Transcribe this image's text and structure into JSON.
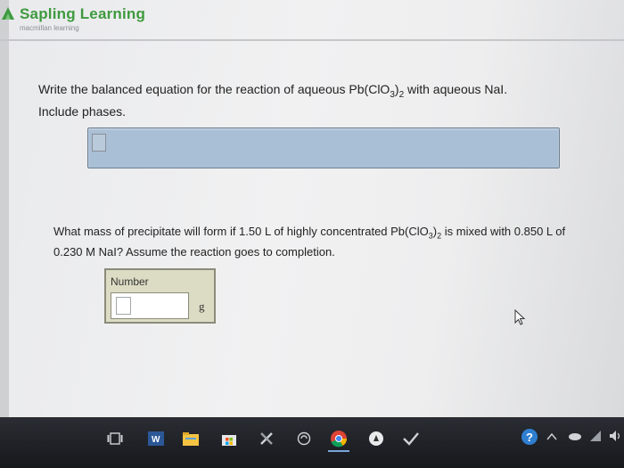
{
  "brand": {
    "name": "Sapling Learning",
    "sub": "macmillan learning",
    "color": "#3e9a3f"
  },
  "question1": {
    "line1_a": "Write the balanced equation for the reaction of aqueous Pb(ClO",
    "line1_sub1": "3",
    "line1_b": ")",
    "line1_sub2": "2",
    "line1_c": " with aqueous NaI.",
    "line2": "Include phases."
  },
  "question2": {
    "line1_a": "What mass of precipitate will form if 1.50 L of highly concentrated Pb(ClO",
    "line1_sub1": "3",
    "line1_b": ")",
    "line1_sub2": "2",
    "line1_c": " is mixed with 0.850 L of",
    "line2": "0.230 M NaI? Assume the reaction goes to completion."
  },
  "answer_box": {
    "label": "Number",
    "value": "",
    "unit": "g"
  },
  "taskbar": {
    "icons": [
      "task-view-icon",
      "word-icon",
      "file-explorer-icon",
      "store-icon",
      "tools-icon",
      "browser-icon",
      "chrome-icon",
      "app-icon",
      "checkmark-app-icon"
    ],
    "tray": [
      "help-icon",
      "chevron-up-icon",
      "cloud-icon",
      "wifi-icon",
      "volume-icon"
    ]
  }
}
